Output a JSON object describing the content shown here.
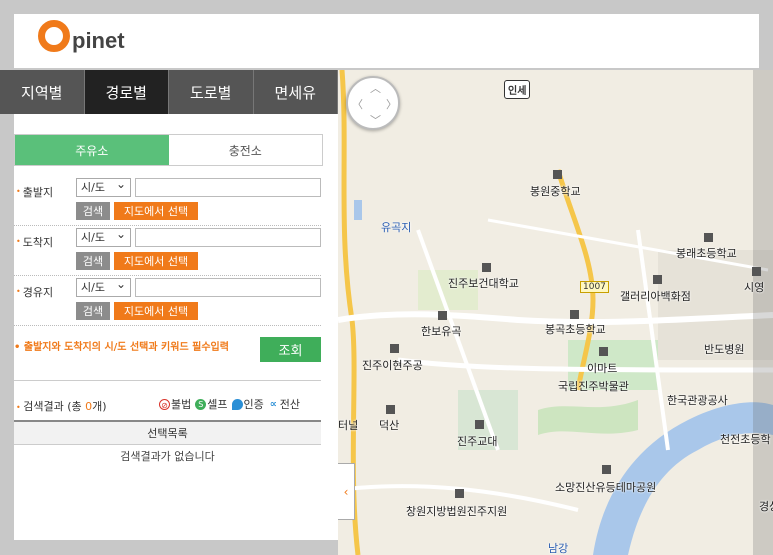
{
  "header": {
    "logo_text": "pinet"
  },
  "tabs": [
    {
      "label": "지역별"
    },
    {
      "label": "경로별"
    },
    {
      "label": "도로별"
    },
    {
      "label": "면세유"
    }
  ],
  "fuel_tabs": [
    {
      "label": "주유소"
    },
    {
      "label": "충전소"
    }
  ],
  "rows": [
    {
      "label": "출발지",
      "select": "시/도",
      "search": "검색",
      "map_select": "지도에서 선택"
    },
    {
      "label": "도착지",
      "select": "시/도",
      "search": "검색",
      "map_select": "지도에서 선택"
    },
    {
      "label": "경유지",
      "select": "시/도",
      "search": "검색",
      "map_select": "지도에서 선택"
    }
  ],
  "notice": "출발지와 도착지의 시/도 선택과 키워드 필수입력",
  "submit": "조회",
  "results": {
    "prefix": "검색결과 (총 ",
    "count": "0",
    "suffix": "개)"
  },
  "legend": [
    {
      "label": "불법",
      "icon": "prohibited-icon",
      "color": "#d9342b"
    },
    {
      "label": "셀프",
      "icon": "self-icon",
      "color": "#3fae5a"
    },
    {
      "label": "인증",
      "icon": "drop-icon",
      "color": "#2a8fd6"
    },
    {
      "label": "전산",
      "icon": "link-icon",
      "color": "#2a8fd6"
    }
  ],
  "table": {
    "header": "선택목록",
    "empty": "검색결과가 없습니다"
  },
  "map": {
    "badge_inse": "인세",
    "road_number": "1007",
    "labels": [
      "봉원중학교",
      "유곡지",
      "봉래초등학교",
      "진주보건대학교",
      "갤러리아백화점",
      "시영",
      "한보유곡",
      "봉곡초등학교",
      "진주이현주공",
      "이마트",
      "반도병원",
      "국립진주박물관",
      "한국관광공사",
      "덕산",
      "진주교대",
      "천전초등학",
      "터널",
      "소망진산유등테마공원",
      "창원지방법원진주지원",
      "남강",
      "경상"
    ]
  },
  "colors": {
    "accent": "#f07a1a",
    "green": "#3fae5a",
    "tab_bg": "#555555",
    "tab_active": "#222222"
  }
}
